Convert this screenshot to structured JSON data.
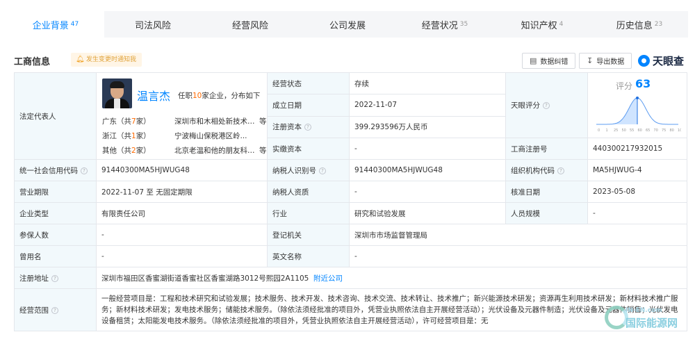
{
  "tabs": [
    {
      "label": "企业背景",
      "count": "47",
      "active": true
    },
    {
      "label": "司法风险",
      "count": ""
    },
    {
      "label": "经营风险",
      "count": ""
    },
    {
      "label": "公司发展",
      "count": ""
    },
    {
      "label": "经营状况",
      "count": "35"
    },
    {
      "label": "知识产权",
      "count": "4"
    },
    {
      "label": "历史信息",
      "count": "23"
    }
  ],
  "header": {
    "title": "工商信息",
    "notice": "发生变更时通知我",
    "btn_correct": "数据纠错",
    "btn_export": "导出数据",
    "brand": "天眼查"
  },
  "rep": {
    "label": "法定代表人",
    "name": "温言杰",
    "desc_pre": "任职",
    "desc_num": "10",
    "desc_post": "家企业，分布如下",
    "rows": [
      {
        "region": "广东（共",
        "n": "7",
        "tail": "家）",
        "company": "深圳市和木相处新技术有限公司",
        "more": "等"
      },
      {
        "region": "浙江（共",
        "n": "1",
        "tail": "家）",
        "company": "宁波梅山保税港区岭...",
        "more": ""
      },
      {
        "region": "其他（共",
        "n": "2",
        "tail": "家）",
        "company": "北京老温和他的朋友科技有限公司",
        "more": "等"
      }
    ]
  },
  "fields": {
    "status_label": "经营状态",
    "status": "存续",
    "found_label": "成立日期",
    "found": "2022-11-07",
    "capital_label": "注册资本",
    "capital": "399.293596万人民币",
    "paid_label": "实缴资本",
    "paid": "-",
    "score_label_row": "天眼评分",
    "score_label": "评分",
    "score": "63",
    "regno_label": "工商注册号",
    "regno": "440300217932015",
    "credit_label": "统一社会信用代码",
    "credit": "91440300MA5HJWUG48",
    "taxid_label": "纳税人识别号",
    "taxid": "91440300MA5HJWUG48",
    "org_label": "组织机构代码",
    "org": "MA5HJWUG-4",
    "term_label": "营业期限",
    "term": "2022-11-07 至 无固定期限",
    "taxq_label": "纳税人资质",
    "taxq": "-",
    "approve_label": "核准日期",
    "approve": "2023-05-08",
    "type_label": "企业类型",
    "type": "有限责任公司",
    "industry_label": "行业",
    "industry": "研究和试验发展",
    "staff_label": "人员规模",
    "staff": "-",
    "insured_label": "参保人数",
    "insured": "-",
    "authority_label": "登记机关",
    "authority": "深圳市市场监督管理局",
    "former_label": "曾用名",
    "former": "-",
    "english_label": "英文名称",
    "english": "-",
    "address_label": "注册地址",
    "address": "深圳市福田区香蜜湖街道香蜜社区香蜜湖路3012号熙园2A1105",
    "nearby": "附近公司",
    "scope_label": "经营范围",
    "scope": "一般经营项目是：工程和技术研究和试验发展；技术服务、技术开发、技术咨询、技术交流、技术转让、技术推广；新兴能源技术研发；资源再生利用技术研发；新材料技术推广服务；新材料技术研发；发电技术服务；储能技术服务。（除依法须经批准的项目外，凭营业执照依法自主开展经营活动）；光伏设备及元器件制造；光伏设备及元器件销售；光伏发电设备租赁；太阳能发电技术服务。（除依法须经批准的项目外，凭营业执照依法自主开展经营活动），许可经营项目是：无"
  },
  "score_axis": [
    "0",
    "1",
    "25",
    "50",
    "55",
    "60",
    "65",
    "70",
    "75",
    "80",
    "100"
  ],
  "watermark": {
    "site": "IN-EN.com",
    "name": "国际能源网"
  }
}
